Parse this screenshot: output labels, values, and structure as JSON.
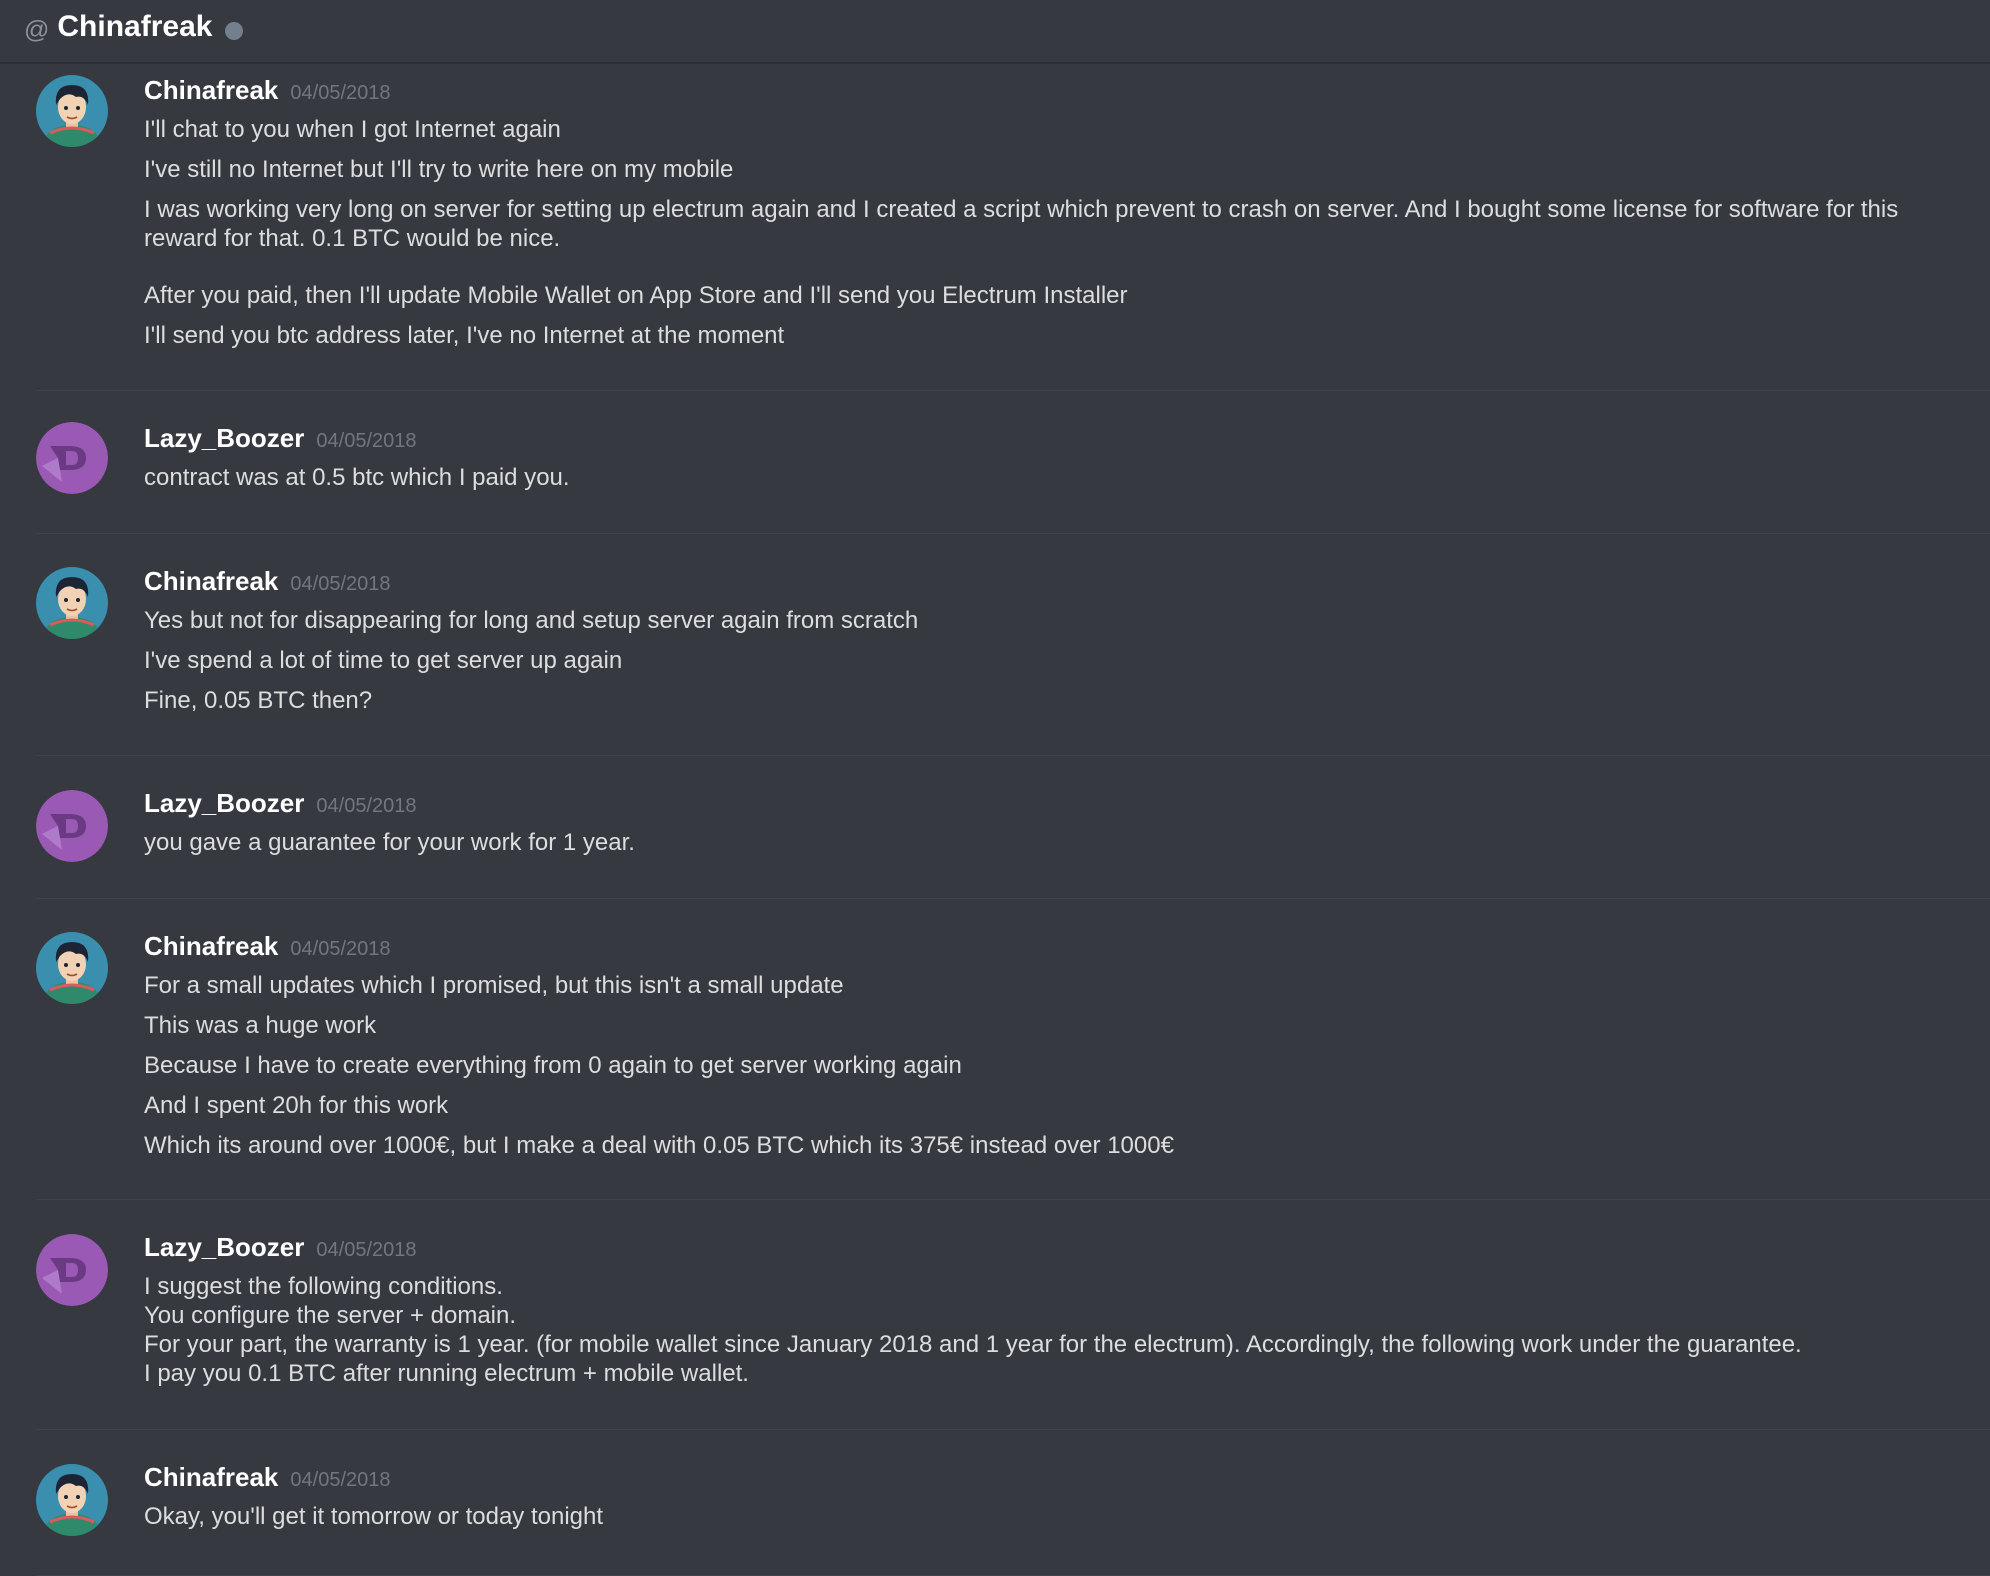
{
  "header": {
    "at_symbol": "@",
    "title": "Chinafreak"
  },
  "colors": {
    "background": "#36393f",
    "author": "#ffffff",
    "timestamp": "#72767d",
    "message": "#dcddde",
    "avatar_purple": "#9b59b6"
  },
  "messages": [
    {
      "author": "Chinafreak",
      "timestamp": "04/05/2018",
      "avatar": "person-avatar-icon",
      "lines": [
        "I'll chat to you when I got Internet again",
        "I've still no Internet but I'll try to write here on my mobile",
        "I was working very long on server for setting up electrum again and I created a script which prevent to crash on server. And I bought some license for software for this",
        "reward for that. 0.1 BTC would be nice.",
        "After you paid, then I'll update Mobile Wallet on App Store and I'll send you Electrum Installer",
        "I'll send you btc address later, I've no Internet at the moment"
      ]
    },
    {
      "author": "Lazy_Boozer",
      "timestamp": "04/05/2018",
      "avatar": "purple-logo-avatar-icon",
      "lines": [
        "contract was at 0.5 btc which I paid you."
      ]
    },
    {
      "author": "Chinafreak",
      "timestamp": "04/05/2018",
      "avatar": "person-avatar-icon",
      "lines": [
        "Yes but not for disappearing for long and setup server again from scratch",
        "I've spend a lot of time to get server up again",
        "Fine, 0.05 BTC then?"
      ]
    },
    {
      "author": "Lazy_Boozer",
      "timestamp": "04/05/2018",
      "avatar": "purple-logo-avatar-icon",
      "lines": [
        "you gave a guarantee for your work for 1 year."
      ]
    },
    {
      "author": "Chinafreak",
      "timestamp": "04/05/2018",
      "avatar": "person-avatar-icon",
      "lines": [
        "For a small updates which I promised, but this isn't a small update",
        "This was a huge work",
        "Because I have to create everything from 0 again to get server working again",
        "And I spent 20h for this work",
        "Which its around over 1000€, but I make a deal with 0.05 BTC which its 375€ instead over 1000€"
      ]
    },
    {
      "author": "Lazy_Boozer",
      "timestamp": "04/05/2018",
      "avatar": "purple-logo-avatar-icon",
      "lines": [
        "I suggest the following conditions.",
        "You configure the server + domain.",
        "For your part, the warranty is 1 year. (for mobile wallet since January 2018 and 1 year for the electrum). Accordingly, the following work under the guarantee.",
        "I pay you 0.1 BTC after running electrum + mobile wallet."
      ]
    },
    {
      "author": "Chinafreak",
      "timestamp": "04/05/2018",
      "avatar": "person-avatar-icon",
      "lines": [
        "Okay, you'll get it tomorrow or today tonight"
      ]
    }
  ]
}
